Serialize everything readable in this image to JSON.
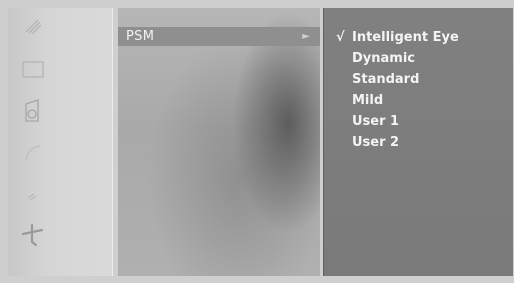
{
  "menu": {
    "selected_item_label": "PSM",
    "submenu_arrow": "►"
  },
  "submenu": {
    "check_glyph": "√",
    "items": [
      {
        "label": "Intelligent Eye",
        "checked": true
      },
      {
        "label": "Dynamic",
        "checked": false
      },
      {
        "label": "Standard",
        "checked": false
      },
      {
        "label": "Mild",
        "checked": false
      },
      {
        "label": "User 1",
        "checked": false
      },
      {
        "label": "User 2",
        "checked": false
      }
    ]
  },
  "side_icons": [
    {
      "name": "channel-icon"
    },
    {
      "name": "picture-icon"
    },
    {
      "name": "sound-icon"
    },
    {
      "name": "time-icon"
    },
    {
      "name": "special-icon"
    },
    {
      "name": "setup-icon"
    }
  ],
  "colors": {
    "submenu_background": "#7d7d7d",
    "highlight_row": "#8f8f8f",
    "text": "#f4f4f4"
  }
}
